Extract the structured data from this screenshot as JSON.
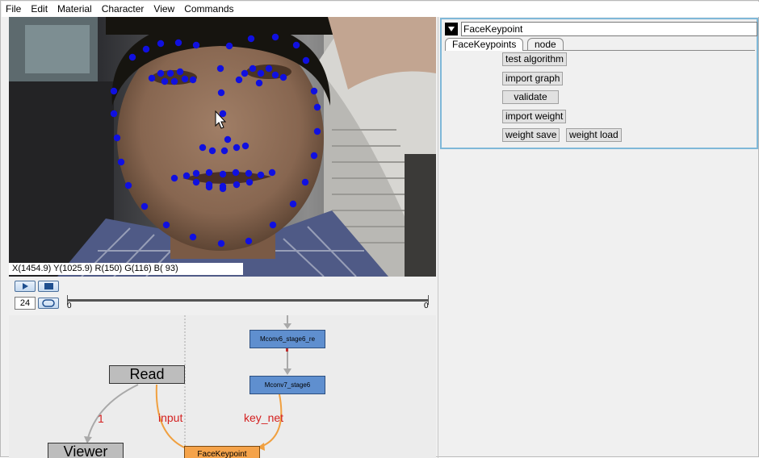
{
  "menu": [
    "File",
    "Edit",
    "Material",
    "Character",
    "View",
    "Commands"
  ],
  "viewer": {
    "pixel_readout": "X(1454.9) Y(1025.9) R(150) G(116) B( 93)"
  },
  "playback": {
    "frame_value": "24",
    "timeline_start": "0",
    "timeline_end": "0"
  },
  "graph": {
    "nodes": {
      "read": "Read",
      "viewer": "Viewer",
      "mconv6": "Mconv6_stage6_re",
      "mconv7": "Mconv7_stage6",
      "facekeypoint": "FaceKeypoint"
    },
    "edges": {
      "read_to_viewer": "1",
      "read_to_face": "input",
      "mconv_to_face": "key_net"
    },
    "colors": {
      "edge_gray": "#a9a9a9",
      "edge_orange": "#f0a040",
      "label_red": "#d42020"
    }
  },
  "panel": {
    "node_name": "FaceKeypoint",
    "tabs": [
      "FaceKeypoints",
      "node"
    ],
    "buttons": {
      "test_algorithm": "test algorithm",
      "import_graph": "import graph",
      "validate": "validate",
      "import_weight": "import weight",
      "weight_save": "weight save",
      "weight_load": "weight load"
    },
    "accent": "#7fb8d8"
  },
  "keypoint_color": "#1010e0"
}
